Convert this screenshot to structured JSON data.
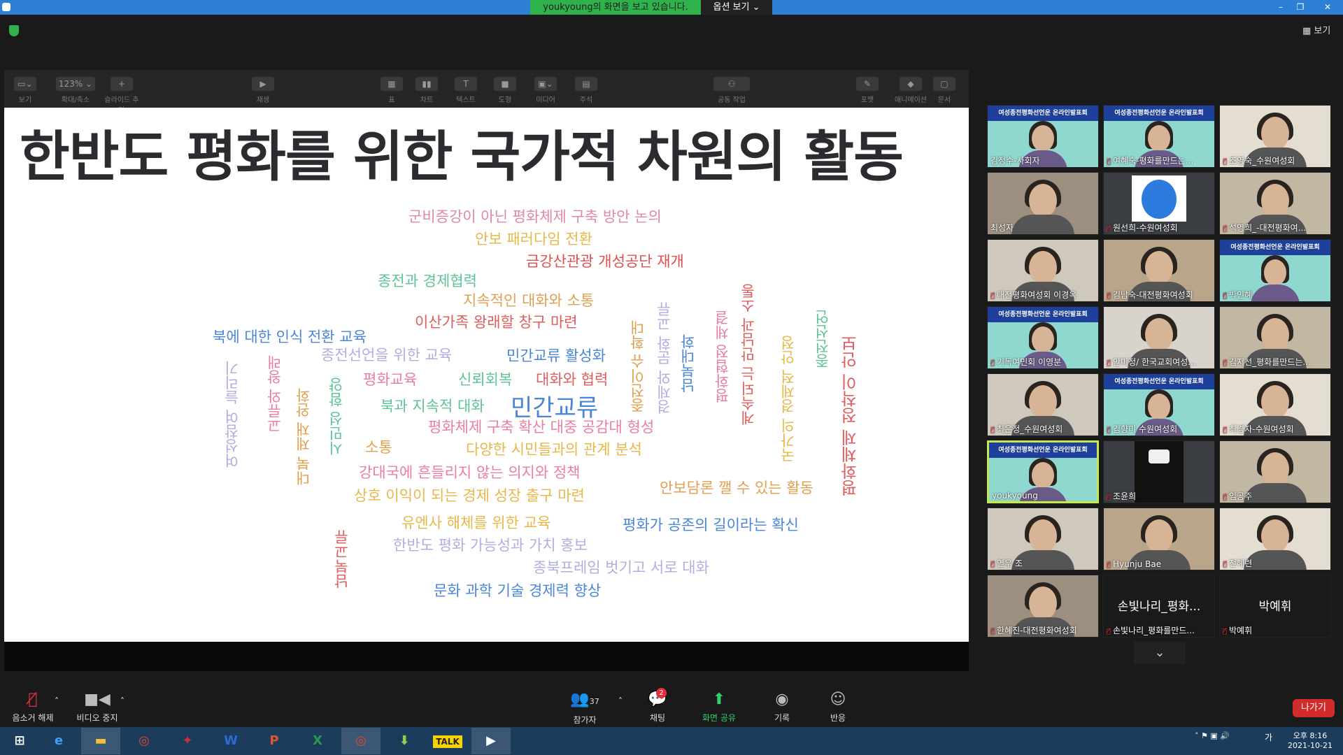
{
  "window": {
    "share_banner": "youkyoung의 화면을 보고 있습니다.",
    "options_label": "옵션 보기 ⌄",
    "view_label": "보기"
  },
  "keynote_toolbar": [
    {
      "label": "보기",
      "icon": "▭⌄"
    },
    {
      "label": "확대/축소",
      "icon": "123% ⌄"
    },
    {
      "label": "슬라이드 추가",
      "icon": "+"
    },
    {
      "label": "재생",
      "icon": "▶"
    },
    {
      "label": "표",
      "icon": "▦"
    },
    {
      "label": "차트",
      "icon": "▮▮"
    },
    {
      "label": "텍스트",
      "icon": "T"
    },
    {
      "label": "도형",
      "icon": "■"
    },
    {
      "label": "미디어",
      "icon": "▣⌄"
    },
    {
      "label": "주석",
      "icon": "▤"
    },
    {
      "label": "공동 작업",
      "icon": "⚇"
    },
    {
      "label": "포맷",
      "icon": "✎"
    },
    {
      "label": "애니메이션",
      "icon": "◆"
    },
    {
      "label": "문서",
      "icon": "▢"
    }
  ],
  "slide": {
    "title": "한반도 평화를 위한 국가적 차원의 활동",
    "words": [
      {
        "text": "군비증강이 아닌 평화체제 구축 방안 논의",
        "color": "#e089a6"
      },
      {
        "text": "안보 패러다임 전환",
        "color": "#e8b74a"
      },
      {
        "text": "금강산관광 개성공단 재개",
        "color": "#e04f4f"
      },
      {
        "text": "종전과 경제협력",
        "color": "#5ec494"
      },
      {
        "text": "지속적인 대화와 소통",
        "color": "#e0a050"
      },
      {
        "text": "이산가족 왕래할 창구 마련",
        "color": "#e05d5d"
      },
      {
        "text": "북에 대한 인식 전환 교육",
        "color": "#4a86d8"
      },
      {
        "text": "종전선언을 위한 교육",
        "color": "#b0aee0"
      },
      {
        "text": "민간교류 활성화",
        "color": "#4a86d8"
      },
      {
        "text": "평화교육",
        "color": "#ea7fa0"
      },
      {
        "text": "신뢰회복",
        "color": "#5ec494"
      },
      {
        "text": "대화와 협력",
        "color": "#e05d5d"
      },
      {
        "text": "북과 지속적 대화",
        "color": "#5ec494"
      },
      {
        "text": "민간교류",
        "color": "#4a86d8"
      },
      {
        "text": "평화체제 구축 확산 대중 공감대 형성",
        "color": "#ea7fa0"
      },
      {
        "text": "소통",
        "color": "#e0a050"
      },
      {
        "text": "다양한 시민들과의 관계 분석",
        "color": "#e8b74a"
      },
      {
        "text": "강대국에 흔들리지 않는 의지와 정책",
        "color": "#ea7fa0"
      },
      {
        "text": "안보담론 깰 수 있는 활동",
        "color": "#e0a050"
      },
      {
        "text": "상호 이익이 되는 경제 성장 출구 마련",
        "color": "#e8b74a"
      },
      {
        "text": "유엔사 해체를 위한 교육",
        "color": "#e8b74a"
      },
      {
        "text": "평화가 공존의 길이라는 확신",
        "color": "#4a86d8"
      },
      {
        "text": "한반도 평화 가능성과 가치 홍보",
        "color": "#b0aee0"
      },
      {
        "text": "종북프레임 벗기고 서로 대화",
        "color": "#b0aee0"
      },
      {
        "text": "문화 과학 기술 경제력 향상",
        "color": "#4a86d8"
      },
      {
        "text": "여성참여 늘리기",
        "color": "#b0aee0"
      },
      {
        "text": "교류와 왕래",
        "color": "#ea7fa0"
      },
      {
        "text": "대북 제재 완화",
        "color": "#e0a050"
      },
      {
        "text": "시민성 함양",
        "color": "#5ec494"
      },
      {
        "text": "남북교류",
        "color": "#e05d5d"
      },
      {
        "text": "종전이슈 확대",
        "color": "#e0a050"
      },
      {
        "text": "경제와 문화 교류",
        "color": "#b0aee0"
      },
      {
        "text": "남북대화",
        "color": "#4a86d8"
      },
      {
        "text": "평화협정 체결",
        "color": "#ea7fa0"
      },
      {
        "text": "계속되는 만남과 소통",
        "color": "#e05d5d"
      },
      {
        "text": "국가의 경제적 안정",
        "color": "#e8b74a"
      },
      {
        "text": "종전선언",
        "color": "#5ec494"
      },
      {
        "text": "평화체제 정착이 안보",
        "color": "#e05d5d"
      }
    ]
  },
  "participants": [
    {
      "name": "김정수-사회자",
      "mic_off": false,
      "style": "banner"
    },
    {
      "name": "여혜숙-평화를만드는...",
      "mic_off": true,
      "style": "banner"
    },
    {
      "name": "조영숙_수원여성회",
      "mic_off": true,
      "style": "room"
    },
    {
      "name": "최성자",
      "mic_off": false,
      "style": "room"
    },
    {
      "name": "원선희-수원여성회",
      "mic_off": true,
      "style": "avatar"
    },
    {
      "name": "석영희_-대전평화여...",
      "mic_off": true,
      "style": "room"
    },
    {
      "name": "대전평화여성회 이경옥",
      "mic_off": true,
      "style": "room"
    },
    {
      "name": "김남숙-대전평화여성회",
      "mic_off": true,
      "style": "room"
    },
    {
      "name": "박인혜",
      "mic_off": true,
      "style": "banner"
    },
    {
      "name": "기독여민회 이영분",
      "mic_off": true,
      "style": "banner"
    },
    {
      "name": "안미정/ 한국교회여성...",
      "mic_off": true,
      "style": "room"
    },
    {
      "name": "김지선_평화를만드는...",
      "mic_off": true,
      "style": "room"
    },
    {
      "name": "최은정_수원여성회",
      "mic_off": true,
      "style": "room"
    },
    {
      "name": "김향미 수원여성회",
      "mic_off": true,
      "style": "banner"
    },
    {
      "name": "최경자-수원여성회",
      "mic_off": true,
      "style": "room"
    },
    {
      "name": "youkyoung",
      "mic_off": false,
      "style": "banner",
      "active": true
    },
    {
      "name": "조윤희",
      "mic_off": true,
      "style": "dark"
    },
    {
      "name": "임공주",
      "mic_off": true,
      "style": "room"
    },
    {
      "name": "연우 조",
      "mic_off": true,
      "style": "room"
    },
    {
      "name": "Hyunju Bae",
      "mic_off": true,
      "style": "room"
    },
    {
      "name": "전혜련",
      "mic_off": true,
      "style": "room"
    },
    {
      "name": "한혜진-대전평화여성회",
      "mic_off": true,
      "style": "room"
    },
    {
      "name": "손빛나리_평화를만드...",
      "mic_off": true,
      "style": "name",
      "big": "손빛나리_평화..."
    },
    {
      "name": "박예휘",
      "mic_off": true,
      "style": "name",
      "big": "박예휘"
    }
  ],
  "banner_text": "여성종전평화선언운 온라인발표회",
  "controls": {
    "mute": "음소거 해제",
    "video": "비디오 중지",
    "participants": "참가자",
    "participants_count": "37",
    "chat": "채팅",
    "chat_badge": "2",
    "share": "화면 공유",
    "record": "기록",
    "reactions": "반응",
    "leave": "나가기"
  },
  "taskbar": {
    "time": "오후 8:16",
    "date": "2021-10-21",
    "ime": "가"
  }
}
